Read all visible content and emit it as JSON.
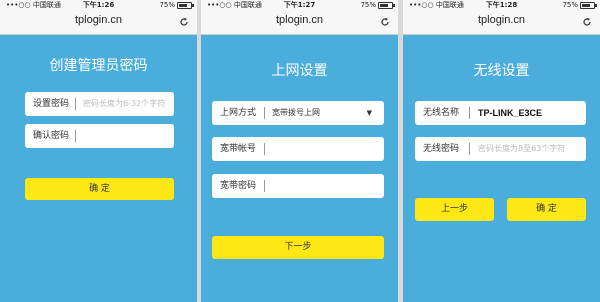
{
  "status": {
    "carrier": "•••○○ 中国联通",
    "battery": "75%",
    "times": [
      "下午1:26",
      "下午1:27",
      "下午1:28"
    ]
  },
  "browser": {
    "url": "tplogin.cn"
  },
  "panel1": {
    "title": "创建管理员密码",
    "fields": [
      {
        "label": "设置密码",
        "placeholder": "密码长度为6-32个字符"
      },
      {
        "label": "确认密码",
        "placeholder": ""
      }
    ],
    "confirm": "确 定"
  },
  "panel2": {
    "title": "上网设置",
    "fields": [
      {
        "label": "上网方式",
        "value": "宽带拨号上网"
      },
      {
        "label": "宽带帐号",
        "value": ""
      },
      {
        "label": "宽带密码",
        "value": ""
      }
    ],
    "next": "下一步"
  },
  "panel3": {
    "title": "无线设置",
    "fields": [
      {
        "label": "无线名称",
        "value": "TP-LINK_E3CE"
      },
      {
        "label": "无线密码",
        "placeholder": "密码长度为8至63个字符"
      }
    ],
    "prev": "上一步",
    "confirm": "确 定"
  }
}
